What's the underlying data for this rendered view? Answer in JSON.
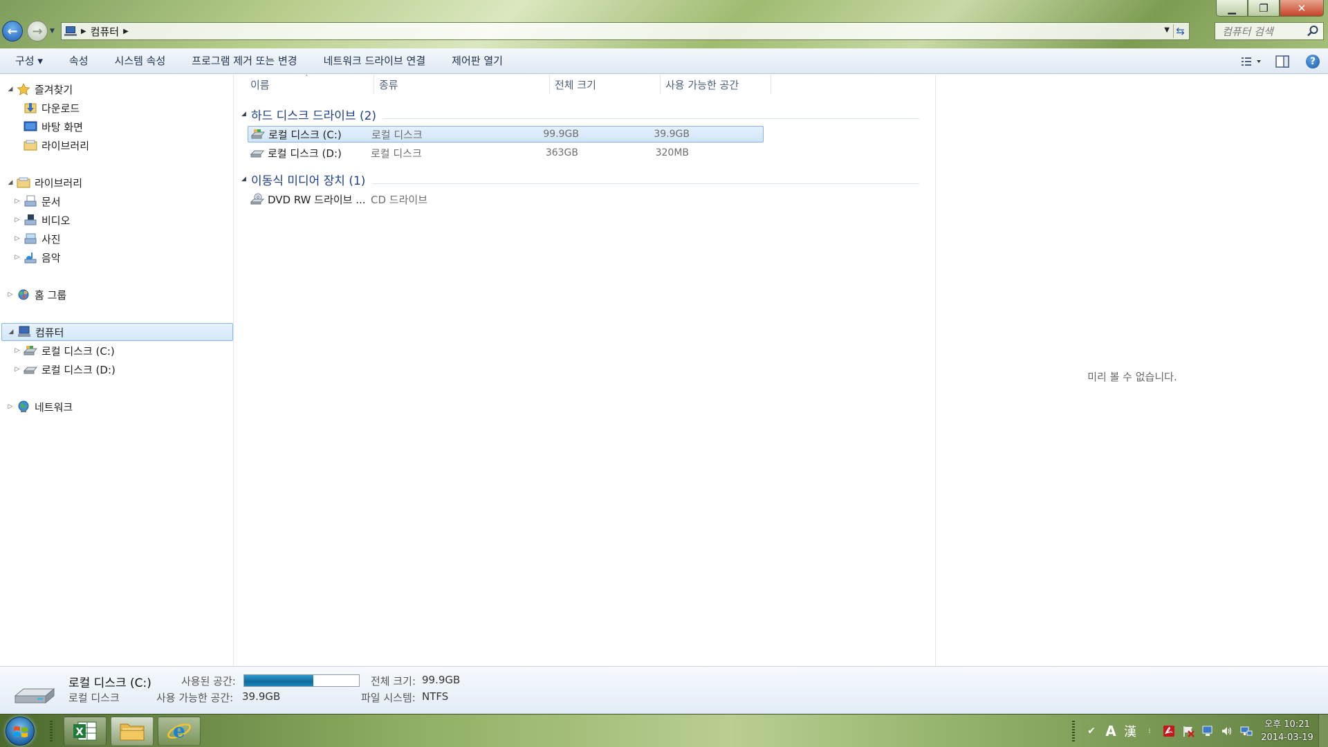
{
  "address": {
    "location": "컴퓨터"
  },
  "search": {
    "placeholder": "컴퓨터 검색"
  },
  "toolbar": {
    "items": [
      {
        "label": "구성 ▾"
      },
      {
        "label": "속성"
      },
      {
        "label": "시스템 속성"
      },
      {
        "label": "프로그램 제거 또는 변경"
      },
      {
        "label": "네트워크 드라이브 연결"
      },
      {
        "label": "제어판 열기"
      }
    ]
  },
  "sidebar": {
    "favorites": "즐겨찾기",
    "favorites_items": [
      "다운로드",
      "바탕 화면",
      "라이브러리"
    ],
    "libraries": "라이브러리",
    "library_items": [
      "문서",
      "비디오",
      "사진",
      "음악"
    ],
    "homegroup": "홈 그룹",
    "computer": "컴퓨터",
    "computer_items": [
      "로컬 디스크 (C:)",
      "로컬 디스크 (D:)"
    ],
    "network": "네트워크"
  },
  "columns": [
    "이름",
    "종류",
    "전체 크기",
    "사용 가능한 공간"
  ],
  "groups": [
    {
      "title": "하드 디스크 드라이브 (2)",
      "items": [
        {
          "name": "로컬 디스크 (C:)",
          "type": "로컬 디스크",
          "total": "99.9GB",
          "free": "39.9GB",
          "selected": true
        },
        {
          "name": "로컬 디스크 (D:)",
          "type": "로컬 디스크",
          "total": "363GB",
          "free": "320MB",
          "selected": false
        }
      ]
    },
    {
      "title": "이동식 미디어 장치 (1)",
      "items": [
        {
          "name": "DVD RW 드라이브 ...",
          "type": "CD 드라이브",
          "total": "",
          "free": "",
          "selected": false
        }
      ]
    }
  ],
  "preview": {
    "message": "미리 볼 수 없습니다."
  },
  "details": {
    "name": "로컬 디스크 (C:)",
    "type": "로컬 디스크",
    "used_label": "사용된 공간:",
    "used_fraction": 0.6,
    "free_label": "사용 가능한 공간:",
    "free_value": "39.9GB",
    "total_label": "전체 크기:",
    "total_value": "99.9GB",
    "fs_label": "파일 시스템:",
    "fs_value": "NTFS"
  },
  "taskbar": {
    "tray_ime": "A",
    "tray_hanja": "漢",
    "time": "오후 10:21",
    "date": "2014-03-19"
  }
}
